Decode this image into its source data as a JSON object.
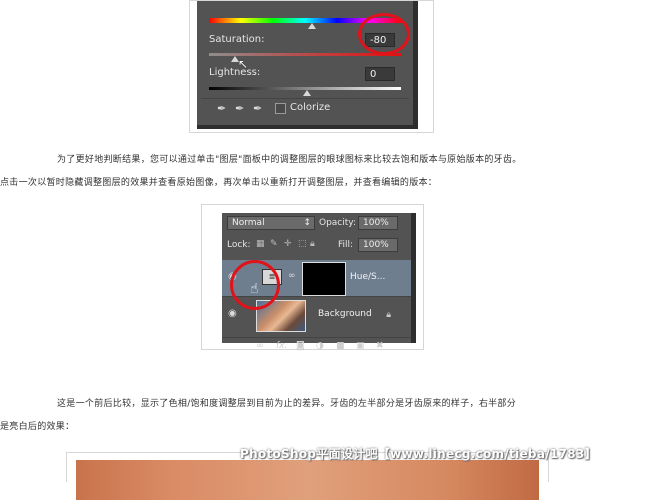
{
  "figure1": {
    "saturation_label": "Saturation:",
    "saturation_value": "-80",
    "lightness_label": "Lightness:",
    "lightness_value": "0",
    "colorize_label": "Colorize"
  },
  "paragraph1": {
    "line1": "为了更好地判断结果，您可以通过单击\"图层\"面板中的调整图层的眼球图标来比较去饱和版本与原始版本的牙齿。",
    "line2": "点击一次以暂时隐藏调整图层的效果并查看原始图像，再次单击以重新打开调整图层，并查看编辑的版本："
  },
  "figure2": {
    "blend_mode": "Normal",
    "opacity_label": "Opacity:",
    "opacity_value": "100%",
    "lock_label": "Lock:",
    "fill_label": "Fill:",
    "fill_value": "100%",
    "layer1_name": "Hue/S...",
    "layer2_name": "Background"
  },
  "paragraph2": {
    "line1": "这是一个前后比较，显示了色相/饱和度调整层到目前为止的差异。牙齿的左半部分是牙齿原来的样子，右半部分",
    "line2": "是亮白后的效果："
  },
  "watermark": "PhotoShop平面设计吧【www.linecg.com/tieba/1783】",
  "colors": {
    "highlight_red": "#e0121a",
    "panel_gray": "#535353"
  }
}
